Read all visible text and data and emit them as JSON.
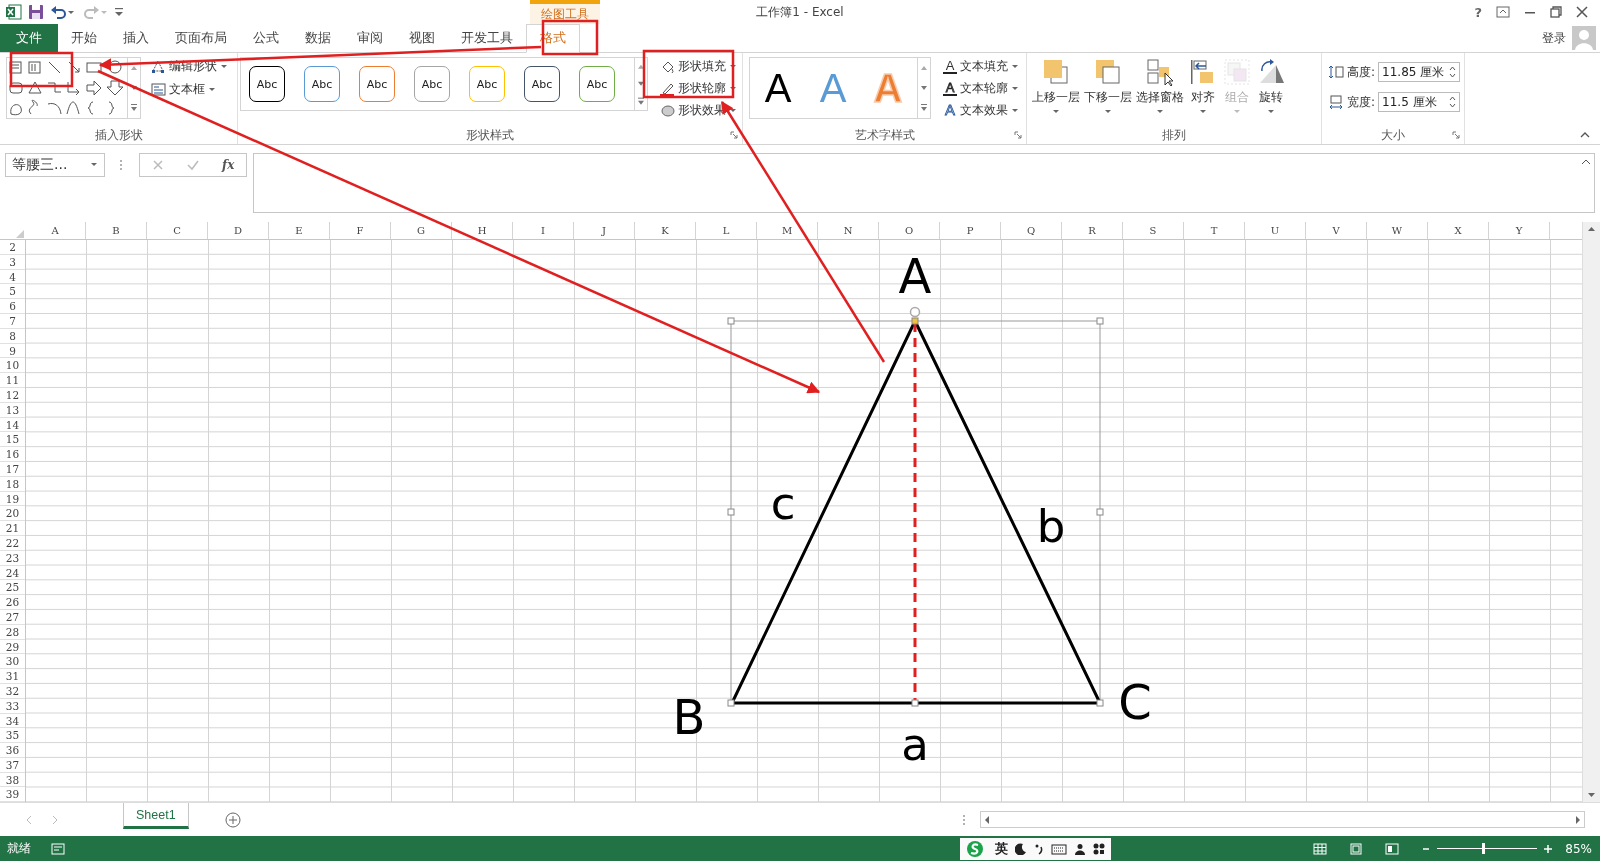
{
  "title_bar": {
    "context_label": "绘图工具",
    "title": "工作簿1 - Excel",
    "help": "?"
  },
  "tabs": [
    {
      "label": "文件",
      "kind": "file",
      "selected": false
    },
    {
      "label": "开始",
      "kind": "tab",
      "selected": false
    },
    {
      "label": "插入",
      "kind": "tab",
      "selected": false
    },
    {
      "label": "页面布局",
      "kind": "tab",
      "selected": false
    },
    {
      "label": "公式",
      "kind": "tab",
      "selected": false
    },
    {
      "label": "数据",
      "kind": "tab",
      "selected": false
    },
    {
      "label": "审阅",
      "kind": "tab",
      "selected": false
    },
    {
      "label": "视图",
      "kind": "tab",
      "selected": false
    },
    {
      "label": "开发工具",
      "kind": "tab",
      "selected": false
    },
    {
      "label": "格式",
      "kind": "context",
      "selected": true
    }
  ],
  "account": {
    "label": "登录"
  },
  "ribbon": {
    "insert_shapes": {
      "title": "插入形状",
      "commands": [
        "编辑形状",
        "文本框"
      ]
    },
    "shape_styles": {
      "title": "形状样式",
      "presets": [
        {
          "label": "Abc",
          "color": "#000000"
        },
        {
          "label": "Abc",
          "color": "#5b9bd5"
        },
        {
          "label": "Abc",
          "color": "#ed7d31"
        },
        {
          "label": "Abc",
          "color": "#a5a5a5"
        },
        {
          "label": "Abc",
          "color": "#ffc000"
        },
        {
          "label": "Abc",
          "color": "#44546a"
        },
        {
          "label": "Abc",
          "color": "#70ad47"
        }
      ],
      "commands": [
        "形状填充",
        "形状轮廓",
        "形状效果"
      ]
    },
    "wordart_styles": {
      "title": "艺术字样式",
      "presets": [
        {
          "label": "A",
          "kind": "solid",
          "color": "#000000"
        },
        {
          "label": "A",
          "kind": "solid",
          "color": "#5b9bd5"
        },
        {
          "label": "A",
          "kind": "outline",
          "color": "#ed7d31"
        }
      ],
      "commands": [
        {
          "icon": "A",
          "kind": "fill",
          "label": "文本填充"
        },
        {
          "icon": "A",
          "kind": "outline",
          "label": "文本轮廓"
        },
        {
          "icon": "A",
          "kind": "effect",
          "label": "文本效果"
        }
      ]
    },
    "arrange": {
      "title": "排列",
      "commands": [
        {
          "label": "上移一层",
          "kind": "forward",
          "disabled": false
        },
        {
          "label": "下移一层",
          "kind": "backward",
          "disabled": false
        },
        {
          "label": "选择窗格",
          "kind": "pane",
          "disabled": false
        },
        {
          "label": "对齐",
          "kind": "align",
          "disabled": false
        },
        {
          "label": "组合",
          "kind": "group",
          "disabled": true
        },
        {
          "label": "旋转",
          "kind": "rotate",
          "disabled": false
        }
      ]
    },
    "size": {
      "title": "大小",
      "fields": [
        {
          "label": "高度:",
          "kind": "height",
          "value": "11.85 厘米"
        },
        {
          "label": "宽度:",
          "kind": "width",
          "value": "11.5 厘米"
        }
      ]
    }
  },
  "formula_bar": {
    "name_box": "等腰三...",
    "function_label": "fx"
  },
  "sheet": {
    "columns": [
      "A",
      "B",
      "C",
      "D",
      "E",
      "F",
      "G",
      "H",
      "I",
      "J",
      "K",
      "L",
      "M",
      "N",
      "O",
      "P",
      "Q",
      "R",
      "S",
      "T",
      "U",
      "V",
      "W",
      "X",
      "Y"
    ],
    "rows": [
      "2",
      "3",
      "4",
      "5",
      "6",
      "7",
      "8",
      "9",
      "10",
      "11",
      "12",
      "13",
      "14",
      "15",
      "16",
      "17",
      "18",
      "19",
      "20",
      "21",
      "22",
      "23",
      "24",
      "25",
      "26",
      "27",
      "28",
      "29",
      "30",
      "31",
      "32",
      "33",
      "34",
      "35",
      "36",
      "37",
      "38",
      "39"
    ],
    "shape_labels": [
      {
        "text": "A",
        "kind": "vertex"
      },
      {
        "text": "B",
        "kind": "vertex"
      },
      {
        "text": "C",
        "kind": "vertex"
      },
      {
        "text": "a",
        "kind": "side"
      },
      {
        "text": "b",
        "kind": "side"
      },
      {
        "text": "c",
        "kind": "side"
      }
    ]
  },
  "annotations": [
    {
      "kind": "box"
    },
    {
      "kind": "box"
    },
    {
      "kind": "box"
    },
    {
      "kind": "arrow"
    },
    {
      "kind": "arrow"
    },
    {
      "kind": "arrow"
    }
  ],
  "sheet_tabs": [
    {
      "label": "Sheet1",
      "selected": true
    }
  ],
  "status_bar": {
    "status": "就绪",
    "ime_language": "英",
    "zoom": "85%",
    "zoom_slider": {
      "level": 0.46
    }
  }
}
